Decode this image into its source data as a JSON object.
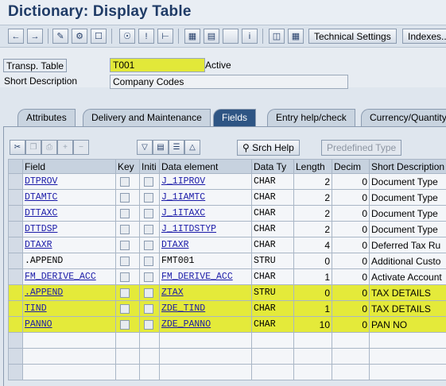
{
  "window": {
    "title": "Dictionary: Display Table"
  },
  "toolbar": {
    "buttons": [
      "back-arrow",
      "forward-arrow",
      "pencil-glasses",
      "object-list",
      "display-change",
      "where-used",
      "info",
      "hierarchy",
      "tree",
      "layout",
      "blank",
      "info-i",
      "columns",
      "grid"
    ],
    "technical_settings": "Technical Settings",
    "indexes": "Indexes..."
  },
  "header": {
    "transp_table_label": "Transp. Table",
    "transp_table_value": "T001",
    "status": "Active",
    "short_desc_label": "Short Description",
    "short_desc_value": "Company Codes"
  },
  "tabs": [
    {
      "label": "Attributes"
    },
    {
      "label": "Delivery and Maintenance"
    },
    {
      "label": "Fields"
    },
    {
      "label": "Entry help/check"
    },
    {
      "label": "Currency/Quantity"
    }
  ],
  "fields_toolbar": {
    "srch_help": "Srch Help",
    "predefined_type": "Predefined Type"
  },
  "table": {
    "columns": [
      "Field",
      "Key",
      "Initi",
      "Data element",
      "Data Ty",
      "Length",
      "Decim",
      "Short Description"
    ],
    "rows": [
      {
        "field": "DTPROV",
        "data_element": "J_1IPROV",
        "type": "CHAR",
        "length": "2",
        "decimals": "0",
        "desc": "Document Type"
      },
      {
        "field": "DTAMTC",
        "data_element": "J_1IAMTC",
        "type": "CHAR",
        "length": "2",
        "decimals": "0",
        "desc": "Document Type"
      },
      {
        "field": "DTTAXC",
        "data_element": "J_1ITAXC",
        "type": "CHAR",
        "length": "2",
        "decimals": "0",
        "desc": "Document Type"
      },
      {
        "field": "DTTDSP",
        "data_element": "J_1ITDSTYP",
        "type": "CHAR",
        "length": "2",
        "decimals": "0",
        "desc": "Document Type"
      },
      {
        "field": "DTAXR",
        "data_element": "DTAXR",
        "type": "CHAR",
        "length": "4",
        "decimals": "0",
        "desc": "Deferred Tax Ru"
      },
      {
        "field": ".APPEND",
        "data_element": "FMT001",
        "type": "STRU",
        "length": "0",
        "decimals": "0",
        "desc": "Additional Custo"
      },
      {
        "field": "FM_DERIVE_ACC",
        "data_element": "FM_DERIVE_ACC",
        "type": "CHAR",
        "length": "1",
        "decimals": "0",
        "desc": "Activate Account"
      },
      {
        "field": ".APPEND",
        "data_element": "ZTAX",
        "type": "STRU",
        "length": "0",
        "decimals": "0",
        "desc": "TAX DETAILS"
      },
      {
        "field": "TIND",
        "data_element": "ZDE_TIND",
        "type": "CHAR",
        "length": "1",
        "decimals": "0",
        "desc": "TAX DETAILS"
      },
      {
        "field": "PANNO",
        "data_element": "ZDE_PANNO",
        "type": "CHAR",
        "length": "10",
        "decimals": "0",
        "desc": "PAN NO"
      }
    ]
  }
}
